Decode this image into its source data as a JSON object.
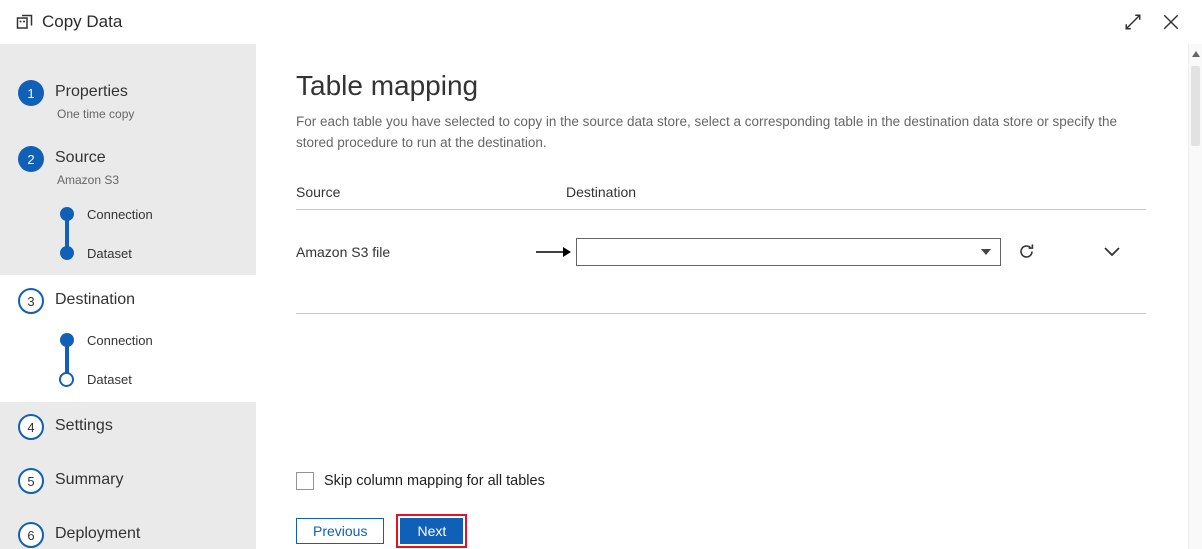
{
  "colors": {
    "accent": "#1160b7",
    "annotation_red": "#e81123",
    "sidebar_bg": "#eaeaea"
  },
  "titlebar": {
    "title": "Copy Data"
  },
  "icons": {
    "app": "copy-data-icon",
    "expand": "expand-icon",
    "close": "close-icon",
    "mapping_arrow": "right-arrow-icon",
    "dropdown_caret": "caret-down-icon",
    "refresh": "refresh-icon",
    "row_expand": "chevron-down-icon",
    "scroll_up": "scroll-up-icon"
  },
  "sidebar": {
    "steps": [
      {
        "number": "1",
        "label": "Properties",
        "sublabel": "One time copy",
        "state": "completed"
      },
      {
        "number": "2",
        "label": "Source",
        "sublabel": "Amazon S3",
        "state": "completed",
        "substeps": [
          {
            "label": "Connection",
            "state": "completed"
          },
          {
            "label": "Dataset",
            "state": "completed"
          }
        ]
      },
      {
        "number": "3",
        "label": "Destination",
        "sublabel": "",
        "state": "current",
        "substeps": [
          {
            "label": "Connection",
            "state": "completed"
          },
          {
            "label": "Dataset",
            "state": "pending"
          }
        ]
      },
      {
        "number": "4",
        "label": "Settings",
        "state": "pending"
      },
      {
        "number": "5",
        "label": "Summary",
        "state": "pending"
      },
      {
        "number": "6",
        "label": "Deployment",
        "state": "pending"
      }
    ]
  },
  "main": {
    "title": "Table mapping",
    "description": "For each table you have selected to copy in the source data store, select a corresponding table in the destination data store or specify the stored procedure to run at the destination.",
    "columns": {
      "source": "Source",
      "destination": "Destination"
    },
    "mapping_row": {
      "source": "Amazon S3 file",
      "destination_value": ""
    },
    "checkbox_label": "Skip column mapping for all tables",
    "buttons": {
      "previous": "Previous",
      "next": "Next"
    }
  }
}
